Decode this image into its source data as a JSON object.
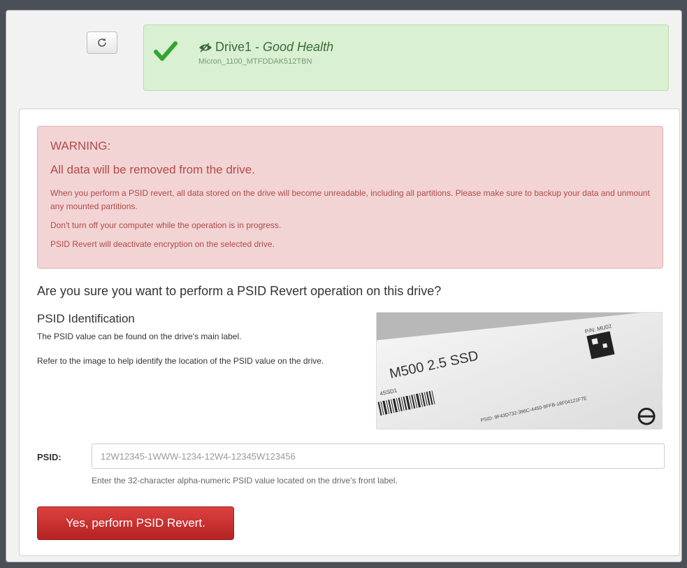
{
  "header": {
    "refresh_icon": "refresh-icon",
    "drive_name": "Drive1",
    "health_separator": " - ",
    "health_status": "Good Health",
    "drive_model": "Micron_1100_MTFDDAK512TBN",
    "status_icon": "check-icon",
    "status_color": "#3a6b34"
  },
  "warning": {
    "title": "WARNING:",
    "subtitle": "All data will be removed from the drive.",
    "line1": "When you perform a PSID revert, all data stored on the drive will become unreadable, including all partitions. Please make sure to backup your data and unmount any mounted partitions.",
    "line2": "Don't turn off your computer while the operation is in progress.",
    "line3": "PSID Revert will deactivate encryption on the selected drive.",
    "color": "#b24a4a"
  },
  "main": {
    "question": "Are you sure you want to perform a PSID Revert operation on this drive?",
    "psid_heading": "PSID Identification",
    "psid_desc1": "The PSID value can be found on the drive's main label.",
    "psid_desc2": "Refer to the image to help identify the location of the PSID value on the drive."
  },
  "label_image": {
    "model_text": "M500 2.5 SSD",
    "pn_text": "P/N: MU02",
    "psid_text": "PSID: 9F43D732-396C-4450-9FFB-18F04121F7E",
    "code_text": "4SSD1"
  },
  "form": {
    "psid_label": "PSID:",
    "psid_placeholder": "12W12345-1WWW-1234-12W4-12345W123456",
    "psid_help": "Enter the 32-character alpha-numeric PSID value located on the drive's front label.",
    "submit_label": "Yes, perform PSID Revert.",
    "submit_color": "#c62c2c"
  }
}
